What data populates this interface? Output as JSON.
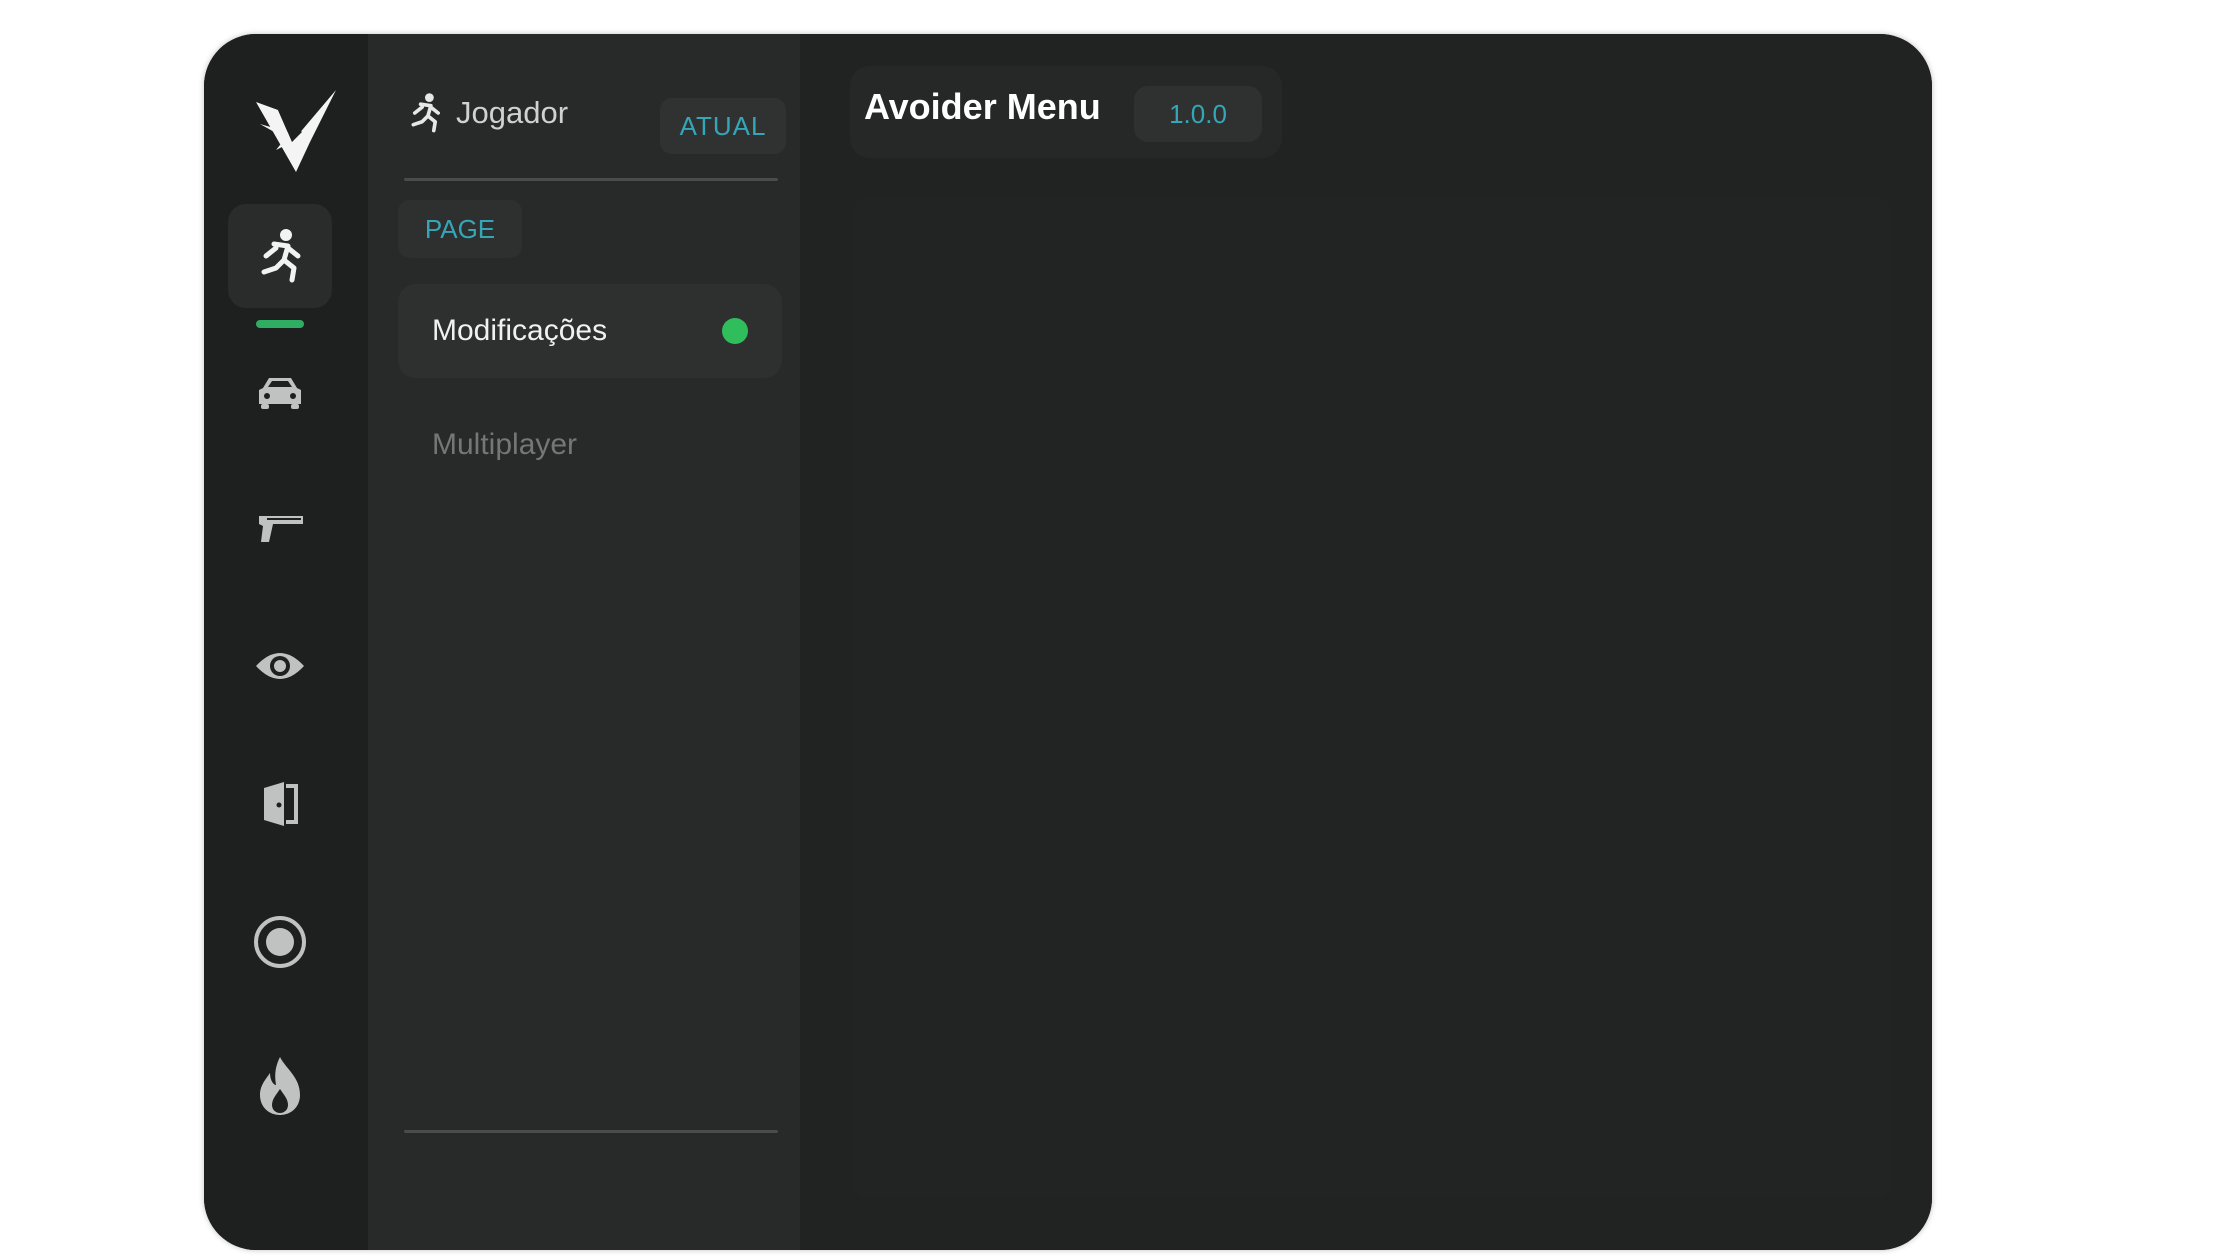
{
  "app": {
    "title": "Avoider Menu",
    "version": "1.0.0"
  },
  "rail": {
    "items": [
      {
        "icon": "running-person-icon",
        "active": true
      },
      {
        "icon": "car-icon",
        "active": false
      },
      {
        "icon": "pistol-icon",
        "active": false
      },
      {
        "icon": "eye-icon",
        "active": false
      },
      {
        "icon": "door-icon",
        "active": false
      },
      {
        "icon": "target-icon",
        "active": false
      },
      {
        "icon": "fire-icon",
        "active": false
      }
    ]
  },
  "panel": {
    "title": "Jogador",
    "badge": "ATUAL",
    "section_label": "PAGE",
    "items": [
      {
        "label": "Modificações",
        "active": true,
        "status": "enabled"
      },
      {
        "label": "Multiplayer",
        "active": false
      }
    ]
  },
  "colors": {
    "accent_teal": "#34a6b8",
    "status_green": "#2fbe5b",
    "indicator_green": "#2fae63",
    "background": "#1f2120"
  }
}
